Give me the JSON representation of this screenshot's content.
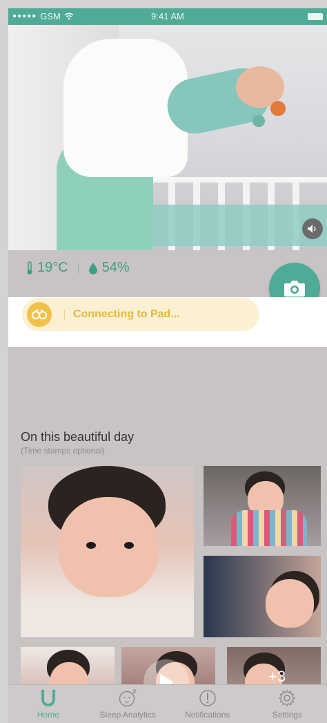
{
  "status_bar": {
    "carrier": "GSM",
    "signal_dots": "●●●●●",
    "time": "9:41 AM"
  },
  "readings": {
    "temperature": "19°C",
    "humidity": "54%"
  },
  "connecting_banner": {
    "text": "Connecting to Pad..."
  },
  "gallery": {
    "title": "On this beautiful day",
    "subtitle": "(Time stamps optional)",
    "more_count": "+3"
  },
  "tabs": [
    {
      "label": "Home",
      "icon": "home-u-icon",
      "active": true
    },
    {
      "label": "Sleep Analytics",
      "icon": "sleep-face-icon",
      "active": false
    },
    {
      "label": "Notifications",
      "icon": "alert-icon",
      "active": false
    },
    {
      "label": "Settings",
      "icon": "gear-icon",
      "active": false
    }
  ],
  "colors": {
    "accent": "#4fab97",
    "banner": "#fbf0d2",
    "banner_icon": "#f0c24a",
    "banner_text": "#e2b93a"
  }
}
